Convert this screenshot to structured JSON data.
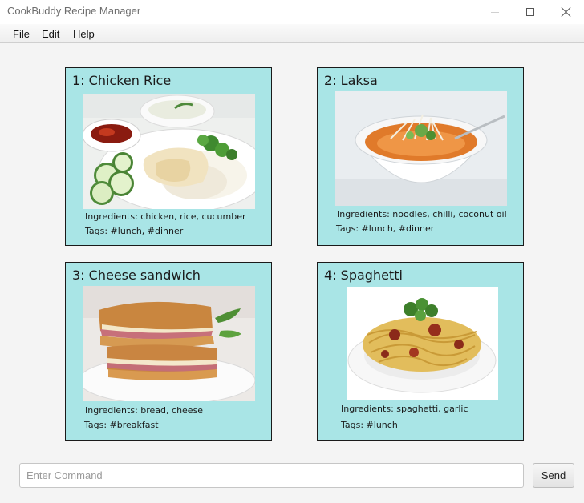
{
  "window": {
    "title": "CookBuddy Recipe Manager"
  },
  "menu": {
    "items": [
      {
        "label": "File"
      },
      {
        "label": "Edit"
      },
      {
        "label": "Help"
      }
    ]
  },
  "recipes": [
    {
      "title": "1: Chicken Rice",
      "ingredients": "Ingredients: chicken, rice, cucumber",
      "tags": "Tags: #lunch, #dinner",
      "photo": "chicken-rice-photo"
    },
    {
      "title": "2: Laksa",
      "ingredients": "Ingredients: noodles, chilli, coconut oil",
      "tags": "Tags: #lunch, #dinner",
      "photo": "laksa-photo"
    },
    {
      "title": "3: Cheese sandwich",
      "ingredients": "Ingredients: bread, cheese",
      "tags": "Tags: #breakfast",
      "photo": "cheese-sandwich-photo"
    },
    {
      "title": "4: Spaghetti",
      "ingredients": "Ingredients: spaghetti, garlic",
      "tags": "Tags: #lunch",
      "photo": "spaghetti-photo"
    }
  ],
  "command": {
    "value": "",
    "placeholder": "Enter Command",
    "send_label": "Send"
  },
  "colors": {
    "card_background": "#a9e5e6",
    "card_border": "#1a1a1a",
    "window_background": "#f4f4f4"
  }
}
